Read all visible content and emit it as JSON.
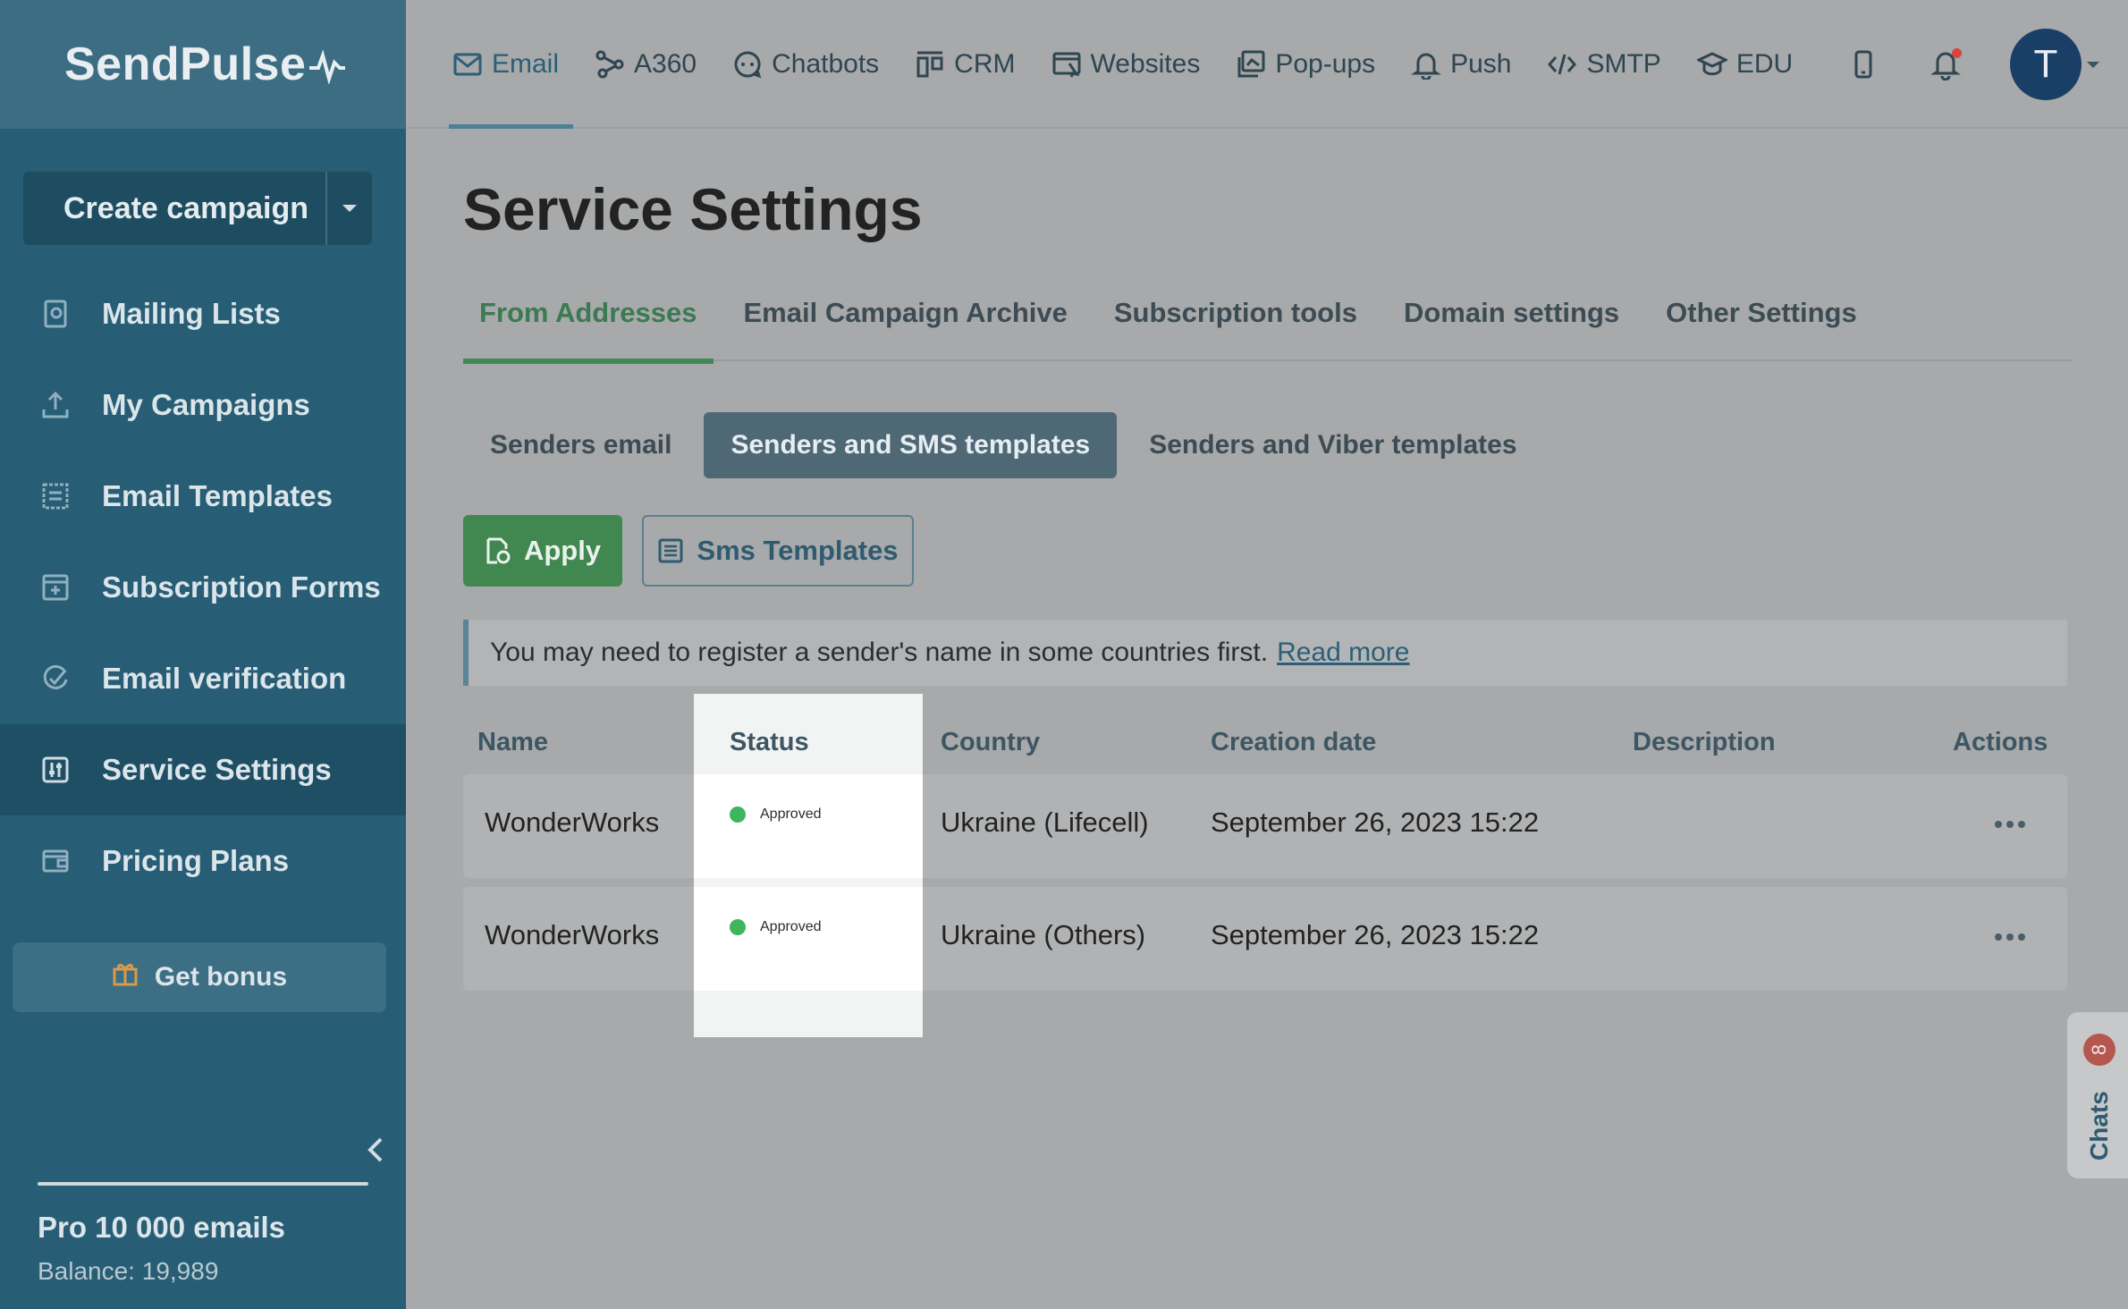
{
  "brand": {
    "name": "SendPulse"
  },
  "sidebar": {
    "create_label": "Create campaign",
    "items": [
      {
        "label": "Mailing Lists",
        "icon": "mailing-list-icon"
      },
      {
        "label": "My Campaigns",
        "icon": "campaigns-icon"
      },
      {
        "label": "Email Templates",
        "icon": "templates-icon"
      },
      {
        "label": "Subscription Forms",
        "icon": "forms-icon"
      },
      {
        "label": "Email verification",
        "icon": "verify-icon"
      },
      {
        "label": "Service Settings",
        "icon": "settings-icon",
        "active": true
      },
      {
        "label": "Pricing Plans",
        "icon": "wallet-icon"
      }
    ],
    "bonus_label": "Get bonus",
    "plan": "Pro 10 000 emails",
    "balance": "Balance: 19,989"
  },
  "topnav": {
    "items": [
      {
        "label": "Email",
        "icon": "mail-icon",
        "active": true
      },
      {
        "label": "A360",
        "icon": "a360-icon"
      },
      {
        "label": "Chatbots",
        "icon": "chatbot-icon"
      },
      {
        "label": "CRM",
        "icon": "crm-icon"
      },
      {
        "label": "Websites",
        "icon": "websites-icon"
      },
      {
        "label": "Pop-ups",
        "icon": "popups-icon"
      },
      {
        "label": "Push",
        "icon": "push-bell-icon"
      },
      {
        "label": "SMTP",
        "icon": "code-icon"
      },
      {
        "label": "EDU",
        "icon": "graduation-cap-icon"
      }
    ],
    "avatar_letter": "T"
  },
  "main": {
    "title": "Service Settings",
    "tabs": [
      {
        "label": "From Addresses",
        "active": true
      },
      {
        "label": "Email Campaign Archive"
      },
      {
        "label": "Subscription tools"
      },
      {
        "label": "Domain settings"
      },
      {
        "label": "Other Settings"
      }
    ],
    "subtabs": [
      {
        "label": "Senders email"
      },
      {
        "label": "Senders and SMS templates",
        "active": true
      },
      {
        "label": "Senders and Viber templates"
      }
    ],
    "apply_label": "Apply",
    "sms_templates_label": "Sms Templates",
    "notice_text": "You may need to register a sender's name in some countries first.",
    "notice_link": "Read more",
    "table": {
      "headers": [
        "Name",
        "Status",
        "Country",
        "Creation date",
        "Description",
        "Actions"
      ],
      "rows": [
        {
          "name": "WonderWorks",
          "status": "Approved",
          "country": "Ukraine (Lifecell)",
          "date": "September 26, 2023 15:22",
          "description": ""
        },
        {
          "name": "WonderWorks",
          "status": "Approved",
          "country": "Ukraine (Others)",
          "date": "September 26, 2023 15:22",
          "description": ""
        }
      ]
    }
  },
  "chats": {
    "label": "Chats",
    "count": "8"
  },
  "colors": {
    "accent_green": "#40884f",
    "sidebar": "#275d75",
    "status_approved": "#3fb55d"
  }
}
